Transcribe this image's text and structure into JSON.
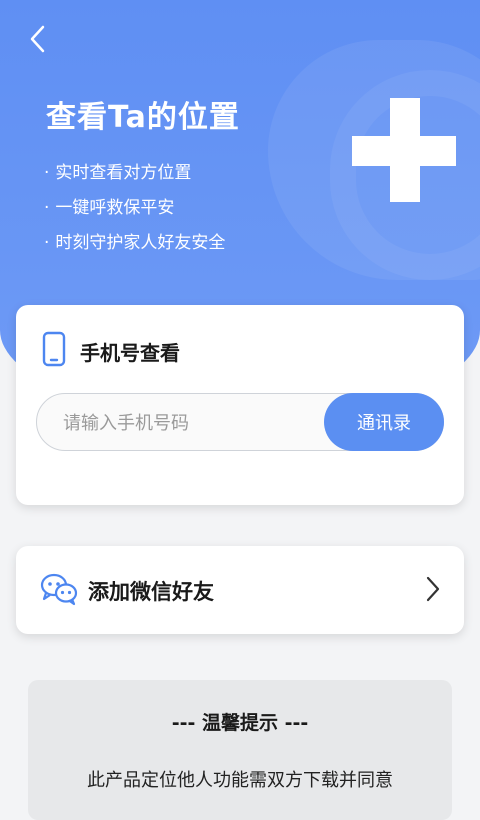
{
  "header": {
    "back_icon": "chevron-left-icon",
    "title": "查看Ta的位置",
    "features": [
      "实时查看对方位置",
      "一键呼救保平安",
      "时刻守护家人好友安全"
    ],
    "bullet": "·",
    "accent_color": "#5f8ff3"
  },
  "phone_lookup": {
    "icon": "smartphone-icon",
    "title": "手机号查看",
    "input_placeholder": "请输入手机号码",
    "input_value": "",
    "contacts_button": "通讯录"
  },
  "wechat": {
    "icon": "wechat-icon",
    "label": "添加微信好友",
    "arrow_icon": "chevron-right-icon"
  },
  "tips": {
    "title": "--- 温馨提示 ---",
    "body": "此产品定位他人功能需双方下载并同意"
  }
}
